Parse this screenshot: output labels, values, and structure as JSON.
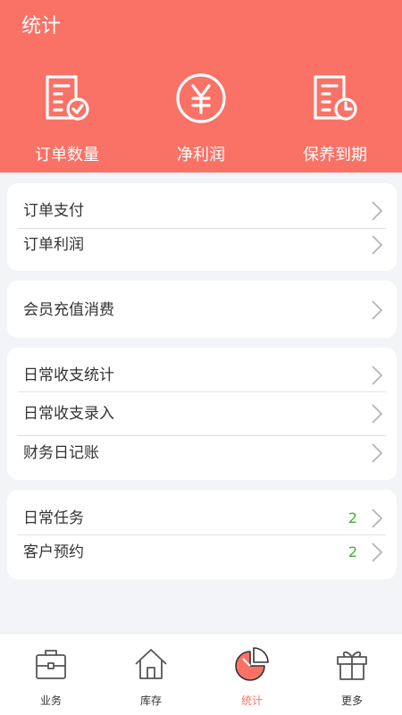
{
  "header": {
    "title": "统计",
    "stats": [
      {
        "label": "订单数量",
        "icon": "document-check-icon"
      },
      {
        "label": "净利润",
        "icon": "yen-circle-icon"
      },
      {
        "label": "保养到期",
        "icon": "document-clock-icon"
      }
    ]
  },
  "cards": [
    {
      "rows": [
        {
          "label": "订单支付"
        },
        {
          "label": "订单利润"
        }
      ]
    },
    {
      "rows": [
        {
          "label": "会员充值消费"
        }
      ]
    },
    {
      "rows": [
        {
          "label": "日常收支统计"
        },
        {
          "label": "日常收支录入"
        },
        {
          "label": "财务日记账"
        }
      ]
    },
    {
      "rows": [
        {
          "label": "日常任务",
          "count": "2"
        },
        {
          "label": "客户预约",
          "count": "2"
        }
      ]
    }
  ],
  "tabbar": {
    "active_color": "#fa7266",
    "items": [
      {
        "label": "业务",
        "icon": "briefcase-icon"
      },
      {
        "label": "库存",
        "icon": "house-icon"
      },
      {
        "label": "统计",
        "icon": "pie-chart-icon",
        "active": true
      },
      {
        "label": "更多",
        "icon": "gift-icon"
      }
    ]
  },
  "colors": {
    "header_bg": "#fa7266",
    "count_text": "#3db039"
  }
}
